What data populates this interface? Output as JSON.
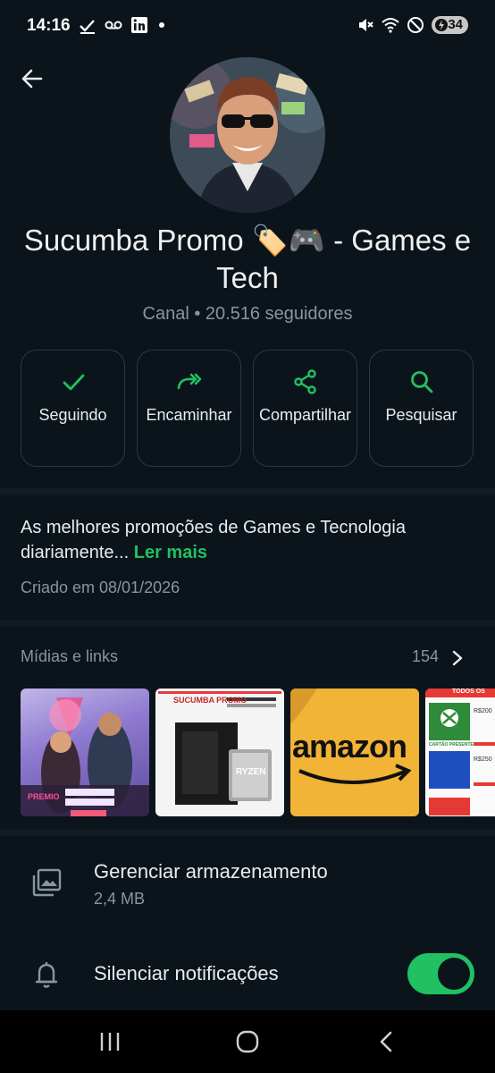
{
  "status_bar": {
    "time": "14:16",
    "battery": "34"
  },
  "channel": {
    "name": "Sucumba Promo 🏷️🎮  - Games e Tech",
    "subtitle": "Canal • 20.516 seguidores",
    "description": "As melhores promoções de Games e Tecnologia diariamente...",
    "read_more": "Ler mais",
    "created": "Criado em 08/01/2026"
  },
  "actions": [
    {
      "label": "Seguindo",
      "icon": "check-icon"
    },
    {
      "label": "Encaminhar",
      "icon": "forward-icon"
    },
    {
      "label": "Compartilhar",
      "icon": "share-icon"
    },
    {
      "label": "Pesquisar",
      "icon": "search-icon"
    }
  ],
  "media": {
    "title": "Mídias e links",
    "count": "154",
    "thumbs": [
      {
        "caption": "PREMIO"
      },
      {
        "caption": "SUCUMBA PROMO",
        "chip": "RYZEN"
      },
      {
        "caption": "amazon"
      },
      {
        "caption": "TODOS OS",
        "tag1": "CARTÃO PRESENTE",
        "price1": "R$200",
        "price2": "R$250"
      }
    ]
  },
  "storage": {
    "title": "Gerenciar armazenamento",
    "size": "2,4 MB"
  },
  "notifications": {
    "title": "Silenciar notificações",
    "muted": true
  },
  "colors": {
    "accent": "#21c063",
    "background": "#0b141a",
    "muted_text": "#8696a0"
  }
}
